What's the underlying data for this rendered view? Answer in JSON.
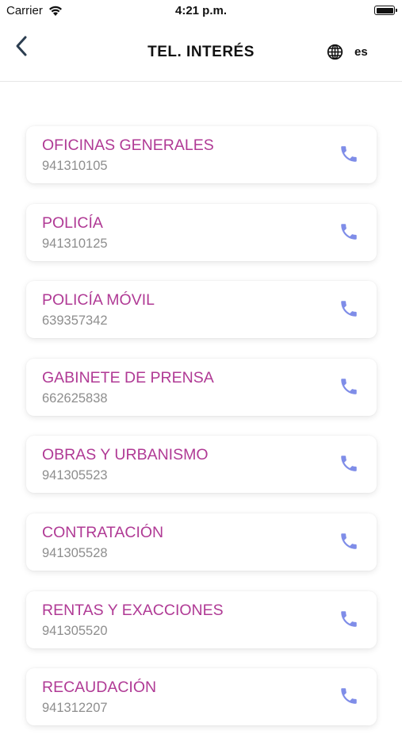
{
  "status_bar": {
    "carrier": "Carrier",
    "time": "4:21 p.m."
  },
  "header": {
    "title": "TEL. INTERÉS",
    "language": "es",
    "back_icon": "chevron-left-icon",
    "globe_icon": "globe-icon"
  },
  "colors": {
    "accent_name": "#b03a95",
    "phone_text": "#8e8e8e",
    "call_icon": "#7f8de8"
  },
  "contacts": [
    {
      "name": "OFICINAS GENERALES",
      "phone": "941310105"
    },
    {
      "name": "POLICÍA",
      "phone": "941310125"
    },
    {
      "name": "POLICÍA MÓVIL",
      "phone": "639357342"
    },
    {
      "name": "GABINETE DE PRENSA",
      "phone": "662625838"
    },
    {
      "name": "OBRAS Y URBANISMO",
      "phone": "941305523"
    },
    {
      "name": "CONTRATACIÓN",
      "phone": "941305528"
    },
    {
      "name": "RENTAS Y EXACCIONES",
      "phone": "941305520"
    },
    {
      "name": "RECAUDACIÓN",
      "phone": "941312207"
    }
  ]
}
